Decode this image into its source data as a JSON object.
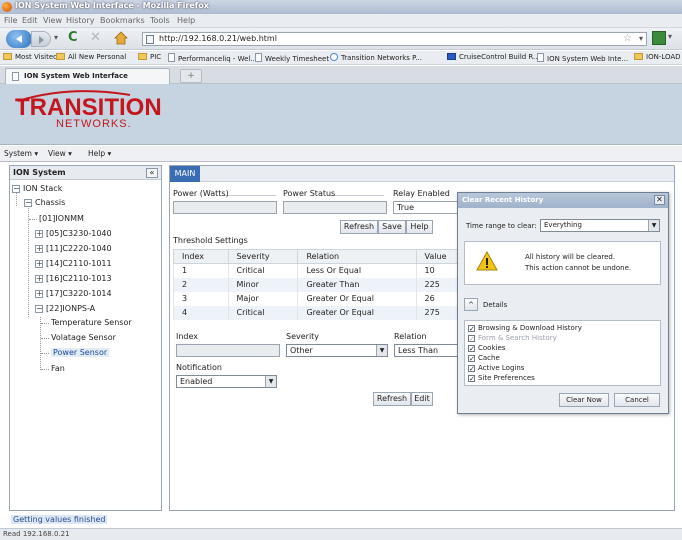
{
  "window": {
    "title": "ION System Web Interface - Mozilla Firefox"
  },
  "browser_menu": [
    "File",
    "Edit",
    "View",
    "History",
    "Bookmarks",
    "Tools",
    "Help"
  ],
  "nav": {
    "url": "http://192.168.0.21/web.html"
  },
  "bookmarks": [
    {
      "label": "Most Visited",
      "icon": "folder"
    },
    {
      "label": "All New Personal",
      "icon": "folder"
    },
    {
      "label": "PIC",
      "icon": "folder"
    },
    {
      "label": "Performanceliq - Wel...",
      "icon": "page"
    },
    {
      "label": "Weekly Timesheet",
      "icon": "page"
    },
    {
      "label": "Transition Networks P...",
      "icon": "circle"
    },
    {
      "label": "CruiseControl Build R...",
      "icon": "blue"
    },
    {
      "label": "ION System Web Inte...",
      "icon": "page"
    },
    {
      "label": "ION-LOAD",
      "icon": "folder"
    }
  ],
  "tab": {
    "label": "ION System Web Interface",
    "new_tab": "+"
  },
  "brand": {
    "line1": "TRANSITION",
    "line2": "NETWORKS."
  },
  "app_menu": [
    "System ▾",
    "View ▾",
    "Help ▾"
  ],
  "left_panel": {
    "title": "ION System",
    "collapse": "«",
    "tree": {
      "root": "ION Stack",
      "chassis": "Chassis",
      "items": [
        "[01]IONMM",
        "[05]C3230-1040",
        "[11]C2220-1040",
        "[14]C2110-1011",
        "[16]C2110-1013",
        "[17]C3220-1014",
        "[22]IONPS-A"
      ],
      "sensors": [
        "Temperature Sensor",
        "Volatage Sensor",
        "Power Sensor",
        "Fan"
      ]
    }
  },
  "main": {
    "tab": "MAIN",
    "power_watts_label": "Power (Watts)",
    "power_status_label": "Power Status",
    "relay_enabled_label": "Relay Enabled",
    "relay_value": "True",
    "refresh": "Refresh",
    "save": "Save",
    "help": "Help",
    "threshold_label": "Threshold Settings",
    "columns": [
      "Index",
      "Severity",
      "Relation",
      "Value"
    ],
    "rows": [
      [
        "1",
        "Critical",
        "Less Or Equal",
        "10"
      ],
      [
        "2",
        "Minor",
        "Greater Than",
        "225"
      ],
      [
        "3",
        "Major",
        "Greater Or Equal",
        "26"
      ],
      [
        "4",
        "Critical",
        "Greater Or Equal",
        "275"
      ]
    ],
    "index_label": "Index",
    "severity_label": "Severity",
    "severity_value": "Other",
    "relation_label": "Relation",
    "relation_value": "Less Than",
    "notification_label": "Notification",
    "notification_value": "Enabled",
    "refresh2": "Refresh",
    "edit": "Edit"
  },
  "dialog": {
    "title": "Clear Recent History",
    "close": "✕",
    "range_label": "Time range to clear:",
    "range_value": "Everything",
    "warning1": "All history will be cleared.",
    "warning2": "This action cannot be undone.",
    "details_label": "Details",
    "options": [
      {
        "label": "Browsing & Download History",
        "checked": true,
        "disabled": false
      },
      {
        "label": "Form & Search History",
        "checked": true,
        "disabled": true
      },
      {
        "label": "Cookies",
        "checked": true,
        "disabled": false
      },
      {
        "label": "Cache",
        "checked": true,
        "disabled": false
      },
      {
        "label": "Active Logins",
        "checked": true,
        "disabled": false
      },
      {
        "label": "Site Preferences",
        "checked": true,
        "disabled": false
      }
    ],
    "clear_now": "Clear Now",
    "cancel": "Cancel"
  },
  "status": {
    "message": "Getting values finished",
    "bar": "Read 192.168.0.21"
  }
}
